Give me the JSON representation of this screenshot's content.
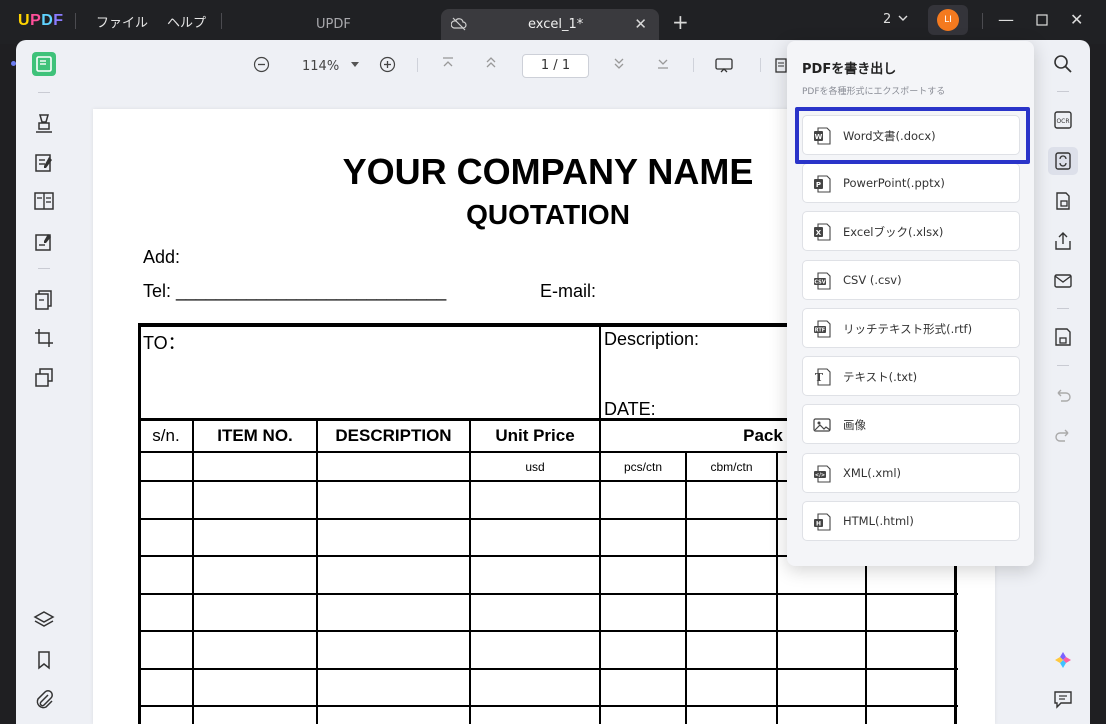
{
  "app": {
    "logo": "UPDF",
    "menu": [
      "ファイル",
      "ヘルプ"
    ],
    "tabs": [
      {
        "label": "UPDF",
        "active": false
      },
      {
        "label": "excel_1*",
        "active": true
      }
    ],
    "page_count": "2",
    "avatar_initials": "LI",
    "accent": "#2a34c9"
  },
  "toolbar": {
    "zoom": "114%",
    "page_indicator": "1 / 1"
  },
  "document": {
    "company": "YOUR COMPANY NAME",
    "doc_type": "QUOTATION",
    "add_label": "Add:",
    "tel_label": "Tel: ___________________________",
    "email_label": "E-mail:",
    "to_label": "TO：",
    "description_label": "Description:",
    "date_label": "DATE:",
    "headers": [
      "s/n.",
      "ITEM NO.",
      "DESCRIPTION",
      "Unit Price",
      "Pack"
    ],
    "subheaders": [
      "usd",
      "pcs/ctn",
      "cbm/ctn"
    ]
  },
  "export_panel": {
    "title": "PDFを書き出し",
    "subtitle": "PDFを各種形式にエクスポートする",
    "items": [
      {
        "label": "Word文書(.docx)",
        "icon": "word-icon"
      },
      {
        "label": "PowerPoint(.pptx)",
        "icon": "powerpoint-icon"
      },
      {
        "label": "Excelブック(.xlsx)",
        "icon": "excel-icon"
      },
      {
        "label": "CSV (.csv)",
        "icon": "csv-icon"
      },
      {
        "label": "リッチテキスト形式(.rtf)",
        "icon": "rtf-icon"
      },
      {
        "label": "テキスト(.txt)",
        "icon": "text-icon"
      },
      {
        "label": "画像",
        "icon": "image-icon"
      },
      {
        "label": "XML(.xml)",
        "icon": "xml-icon"
      },
      {
        "label": "HTML(.html)",
        "icon": "html-icon"
      }
    ]
  }
}
